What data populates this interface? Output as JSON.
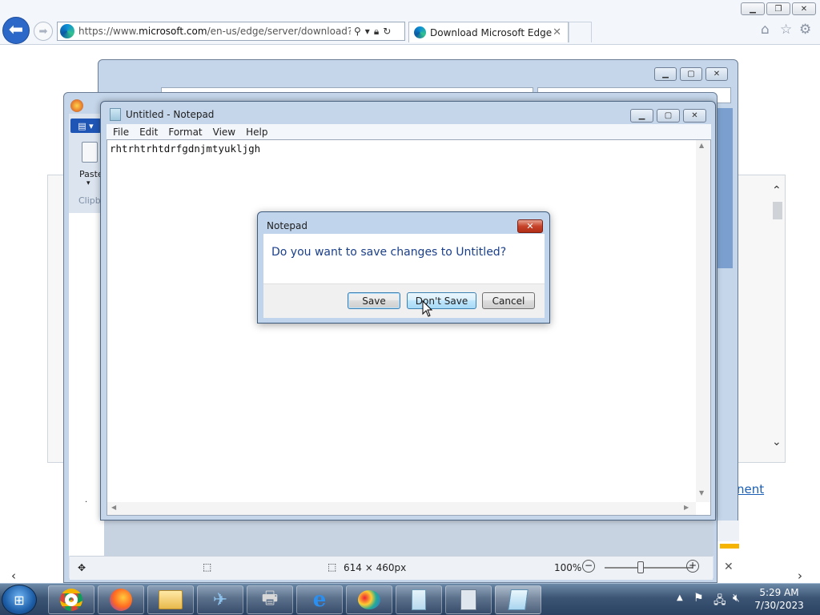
{
  "browser": {
    "url_prefix": "https://www.",
    "url_domain": "microsoft.com",
    "url_rest": "/en-us/edge/server/download?form",
    "tab_title": "Download Microsoft Edge",
    "page_link_text": "nent"
  },
  "paint": {
    "paste_label": "Paste",
    "clipboard_label": "Clipb",
    "dimensions": "614 × 460px",
    "zoom": "100%"
  },
  "notepad": {
    "title": "Untitled - Notepad",
    "menu": [
      "File",
      "Edit",
      "Format",
      "View",
      "Help"
    ],
    "content": "rhtrhtrhtdrfgdnjmtyukljgh"
  },
  "dialog": {
    "title": "Notepad",
    "message": "Do you want to save changes to Untitled?",
    "save": "Save",
    "dont_save": "Don't Save",
    "cancel": "Cancel"
  },
  "taskbar": {
    "time": "5:29 AM",
    "date": "7/30/2023"
  }
}
